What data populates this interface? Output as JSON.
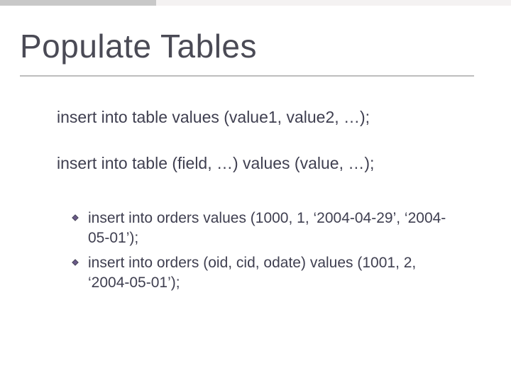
{
  "slide": {
    "title": "Populate Tables",
    "syntax": [
      "insert into table values (value1, value2, …);",
      "insert into table (field, …) values (value, …);"
    ],
    "examples": [
      "insert into orders values (1000, 1, ‘2004-04-29’, ‘2004-05-01’);",
      "insert into orders (oid, cid, odate) values (1001, 2, ‘2004-05-01’);"
    ]
  }
}
